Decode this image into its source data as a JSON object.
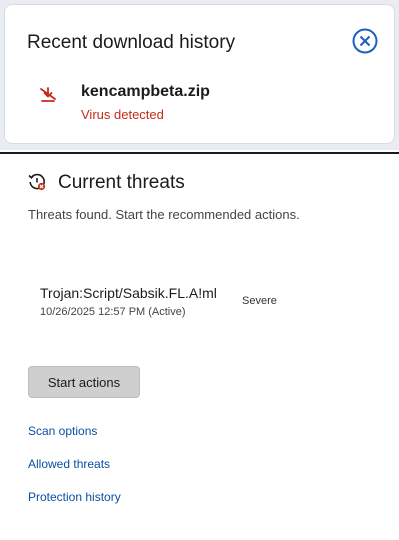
{
  "download_flyout": {
    "title": "Recent download history",
    "items": [
      {
        "file_name": "kencampbeta.zip",
        "status": "Virus detected"
      }
    ]
  },
  "threats_panel": {
    "title": "Current threats",
    "subtitle": "Threats found. Start the recommended actions.",
    "threats": [
      {
        "name": "Trojan:Script/Sabsik.FL.A!ml",
        "date": "10/26/2025 12:57 PM (Active)",
        "severity": "Severe"
      }
    ],
    "start_button": "Start actions",
    "links": {
      "scan_options": "Scan options",
      "allowed_threats": "Allowed threats",
      "protection_history": "Protection history"
    }
  },
  "colors": {
    "danger": "#c42b1c",
    "link": "#0a4fa3",
    "close_accent": "#1f5fbf"
  },
  "icons": {
    "download_blocked": "blocked-download-icon",
    "close": "close-icon",
    "threat": "threat-clock-icon"
  }
}
